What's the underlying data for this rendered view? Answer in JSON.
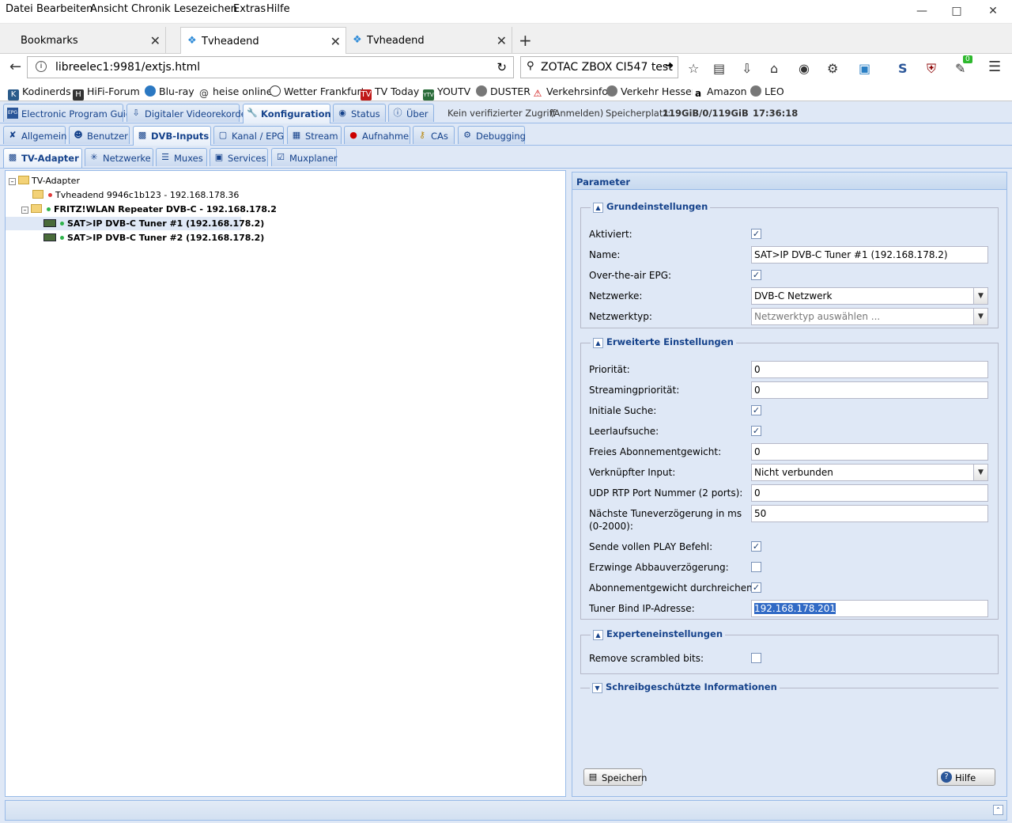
{
  "menu": [
    "Datei",
    "Bearbeiten",
    "Ansicht",
    "Chronik",
    "Lesezeichen",
    "Extras",
    "Hilfe"
  ],
  "tabs": [
    {
      "label": "Bookmarks"
    },
    {
      "label": "Tvheadend"
    },
    {
      "label": "Tvheadend"
    }
  ],
  "url": "libreelec1:9981/extjs.html",
  "search": "ZOTAC ZBOX CI547 test",
  "badge": "0",
  "bookmarks": [
    "Kodinerds",
    "HiFi-Forum",
    "Blu-ray",
    "heise online",
    "Wetter Frankfurt",
    "TV Today",
    "YOUTV",
    "DUSTER",
    "Verkehrsinfo",
    "Verkehr Hessen",
    "Amazon",
    "LEO"
  ],
  "main_tabs": [
    "Electronic Program Guide",
    "Digitaler Videorekorder",
    "Konfiguration",
    "Status",
    "Über"
  ],
  "access": {
    "text": "Kein verifizierter Zugriff",
    "login": "(Anmelden)",
    "storage_label": "Speicherplatz:",
    "storage_value": "119GiB/0/119GiB",
    "time": "17:36:18"
  },
  "config_tabs": [
    "Allgemein",
    "Benutzer",
    "DVB-Inputs",
    "Kanal / EPG",
    "Stream",
    "Aufnahme",
    "CAs",
    "Debugging"
  ],
  "dvb_tabs": [
    "TV-Adapter",
    "Netzwerke",
    "Muxes",
    "Services",
    "Muxplaner"
  ],
  "tree": {
    "root": "TV-Adapter",
    "node1": "Tvheadend 9946c1b123 - 192.168.178.36",
    "node2": "FRITZ!WLAN Repeater DVB-C - 192.168.178.2",
    "tuner1": "SAT>IP DVB-C Tuner #1 (192.168.178.2)",
    "tuner2": "SAT>IP DVB-C Tuner #2 (192.168.178.2)"
  },
  "param": {
    "title": "Parameter",
    "basic": {
      "legend": "Grundeinstellungen",
      "enabled_label": "Aktiviert:",
      "name_label": "Name:",
      "name_value": "SAT>IP DVB-C Tuner #1 (192.168.178.2)",
      "ota_label": "Over-the-air EPG:",
      "networks_label": "Netzwerke:",
      "networks_value": "DVB-C Netzwerk",
      "nettype_label": "Netzwerktyp:",
      "nettype_placeholder": "Netzwerktyp auswählen ..."
    },
    "advanced": {
      "legend": "Erweiterte Einstellungen",
      "priority_label": "Priorität:",
      "priority_value": "0",
      "streampri_label": "Streamingpriorität:",
      "streampri_value": "0",
      "initscan_label": "Initiale Suche:",
      "idlescan_label": "Leerlaufsuche:",
      "freeweight_label": "Freies Abonnementgewicht:",
      "freeweight_value": "0",
      "linked_label": "Verknüpfter Input:",
      "linked_value": "Nicht verbunden",
      "udp_label": "UDP RTP Port Nummer (2 ports):",
      "udp_value": "0",
      "tunedelay_label_1": "Nächste Tuneverzögerung in ms",
      "tunedelay_label_2": "(0-2000):",
      "tunedelay_value": "50",
      "play_label": "Sende vollen PLAY Befehl:",
      "teardown_label": "Erzwinge Abbauverzögerung:",
      "passweight_label": "Abonnementgewicht durchreichen:",
      "bindip_label": "Tuner Bind IP-Adresse:",
      "bindip_value": "192.168.178.201"
    },
    "expert": {
      "legend": "Experteneinstellungen",
      "scrambled_label": "Remove scrambled bits:"
    },
    "readonly": {
      "legend": "Schreibgeschützte Informationen"
    },
    "save": "Speichern",
    "help": "Hilfe"
  }
}
